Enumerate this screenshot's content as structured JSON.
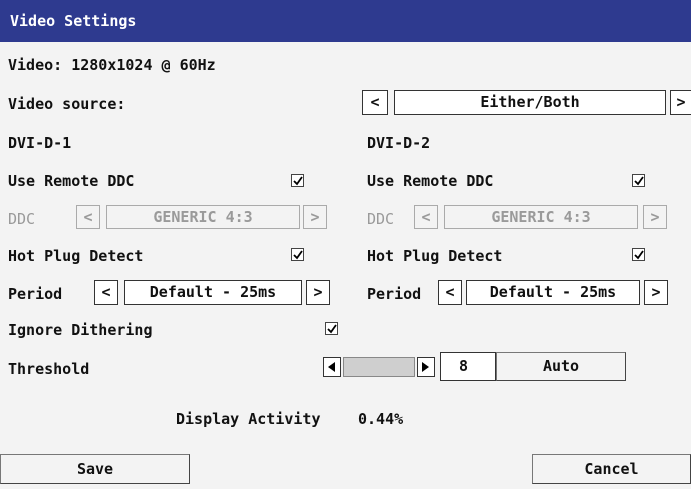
{
  "window": {
    "title": "Video Settings"
  },
  "video_info": "Video: 1280x1024 @ 60Hz",
  "video_source": {
    "label": "Video source:",
    "value": "Either/Both",
    "prev": "<",
    "next": ">"
  },
  "left": {
    "header": "DVI-D-1",
    "use_remote_ddc": {
      "label": "Use Remote DDC",
      "checked": true
    },
    "ddc": {
      "label": "DDC",
      "value": "GENERIC 4:3",
      "prev": "<",
      "next": ">"
    },
    "hot_plug": {
      "label": "Hot Plug Detect",
      "checked": true
    },
    "period": {
      "label": "Period",
      "value": "Default - 25ms",
      "prev": "<",
      "next": ">"
    }
  },
  "right": {
    "header": "DVI-D-2",
    "use_remote_ddc": {
      "label": "Use Remote DDC",
      "checked": true
    },
    "ddc": {
      "label": "DDC",
      "value": "GENERIC 4:3",
      "prev": "<",
      "next": ">"
    },
    "hot_plug": {
      "label": "Hot Plug Detect",
      "checked": true
    },
    "period": {
      "label": "Period",
      "value": "Default - 25ms",
      "prev": "<",
      "next": ">"
    }
  },
  "ignore_dithering": {
    "label": "Ignore Dithering",
    "checked": true
  },
  "threshold": {
    "label": "Threshold",
    "value": "8",
    "auto_label": "Auto"
  },
  "display_activity": {
    "label": "Display Activity",
    "value": "0.44%"
  },
  "footer": {
    "save": "Save",
    "cancel": "Cancel"
  }
}
